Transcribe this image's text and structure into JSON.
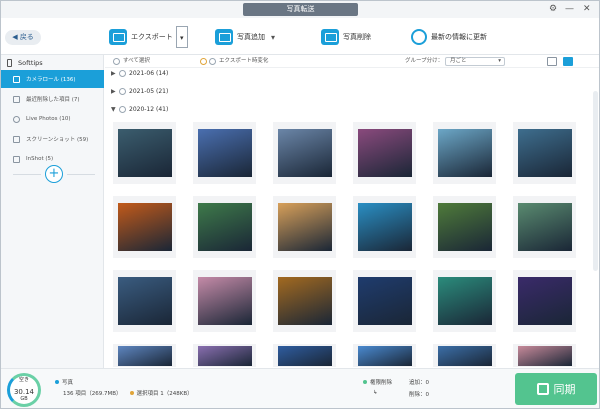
{
  "window": {
    "title": "写真転送"
  },
  "toolbar": {
    "back_label": "戻る",
    "export_label": "エクスポート",
    "add_label": "写真追加",
    "delete_label": "写真削除",
    "refresh_label": "最新の情報に更新"
  },
  "sidebar": {
    "device_name": "Softtips",
    "items": [
      {
        "label": "カメラロール (136)"
      },
      {
        "label": "最近削除した項目 (7)"
      },
      {
        "label": "Live Photos (10)"
      },
      {
        "label": "スクリーンショット (59)"
      },
      {
        "label": "InShot (5)"
      }
    ]
  },
  "filter": {
    "select_all": "すべて選択",
    "export_format": "エクスポート時変化",
    "group_by_label": "グループ分け：",
    "group_by_value": "月ごと"
  },
  "groups": [
    {
      "label": "2021-06 (14)"
    },
    {
      "label": "2021-05 (21)"
    },
    {
      "label": "2020-12 (41)"
    }
  ],
  "photos": [
    {
      "desc": "aerial-river",
      "color": "#3b5d6e"
    },
    {
      "desc": "sea-cliffs",
      "color": "#4a6fb0"
    },
    {
      "desc": "stone-arch",
      "color": "#6b86a8"
    },
    {
      "desc": "purple-sunset-sea",
      "color": "#8a4a7d"
    },
    {
      "desc": "fantasy-castle",
      "color": "#6ca7c7"
    },
    {
      "desc": "lake-mountains",
      "color": "#3e6e8e"
    },
    {
      "desc": "palm-sunset",
      "color": "#c25a1a"
    },
    {
      "desc": "forest-waterfall",
      "color": "#3e7a4a"
    },
    {
      "desc": "golden-pier",
      "color": "#d8a05a"
    },
    {
      "desc": "ocean-boardwalk",
      "color": "#2a8fc4"
    },
    {
      "desc": "jungle-falls",
      "color": "#4f7b3a"
    },
    {
      "desc": "green-valley",
      "color": "#5a8b70"
    },
    {
      "desc": "cloud-sea",
      "color": "#3a5c80"
    },
    {
      "desc": "bridge-dusk",
      "color": "#c58ba8"
    },
    {
      "desc": "golden-texture",
      "color": "#a36a20"
    },
    {
      "desc": "night-forest",
      "color": "#1f3c6e"
    },
    {
      "desc": "waterfall-lagoon",
      "color": "#2b8c7c"
    },
    {
      "desc": "city-tower-night",
      "color": "#3a2a6a"
    },
    {
      "desc": "partial-1",
      "color": "#5e86c0"
    },
    {
      "desc": "partial-2",
      "color": "#8a6fb0"
    },
    {
      "desc": "partial-3",
      "color": "#2f5da0"
    },
    {
      "desc": "partial-4",
      "color": "#4a8ad0"
    },
    {
      "desc": "partial-5",
      "color": "#3c6fa8"
    },
    {
      "desc": "partial-6",
      "color": "#c78a9a"
    }
  ],
  "status": {
    "free_label": "空き",
    "free_value": "30.14",
    "free_unit": "GB",
    "photos_label": "写真",
    "photos_count": "136 項目（269.7MB）",
    "selected": "選択項目 1（248KB）",
    "sync_option": "権限削除",
    "add_count": "追加：0",
    "delete_count": "削除：0",
    "sync_button": "同期"
  },
  "colors": {
    "accent": "#1b9fd9",
    "sync": "#53c48f"
  }
}
